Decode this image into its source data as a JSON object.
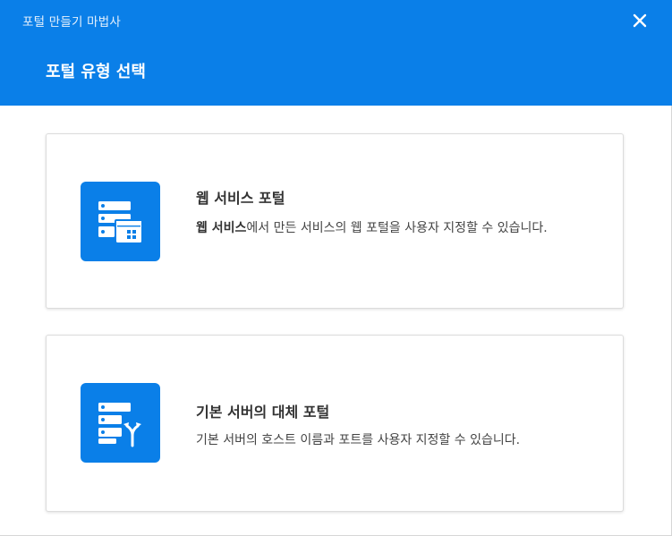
{
  "window": {
    "title": "포털 만들기 마법사",
    "close_icon": "close-icon"
  },
  "header": {
    "title": "포털 유형 선택",
    "background": "#0a7fe8"
  },
  "options": [
    {
      "title": "웹 서비스 포털",
      "desc_bold": "웹 서비스",
      "desc_rest": "에서 만든 서비스의 웹 포털을 사용자 지정할 수 있습니다.",
      "icon": "web-service-portal-icon"
    },
    {
      "title": "기본 서버의 대체 포털",
      "desc_bold": "",
      "desc_rest": "기본 서버의 호스트 이름과 포트를 사용자 지정할 수 있습니다.",
      "icon": "server-alternate-portal-icon"
    }
  ],
  "colors": {
    "accent": "#0a7fe8",
    "card_border": "#dcdcdc",
    "text": "#333333"
  }
}
